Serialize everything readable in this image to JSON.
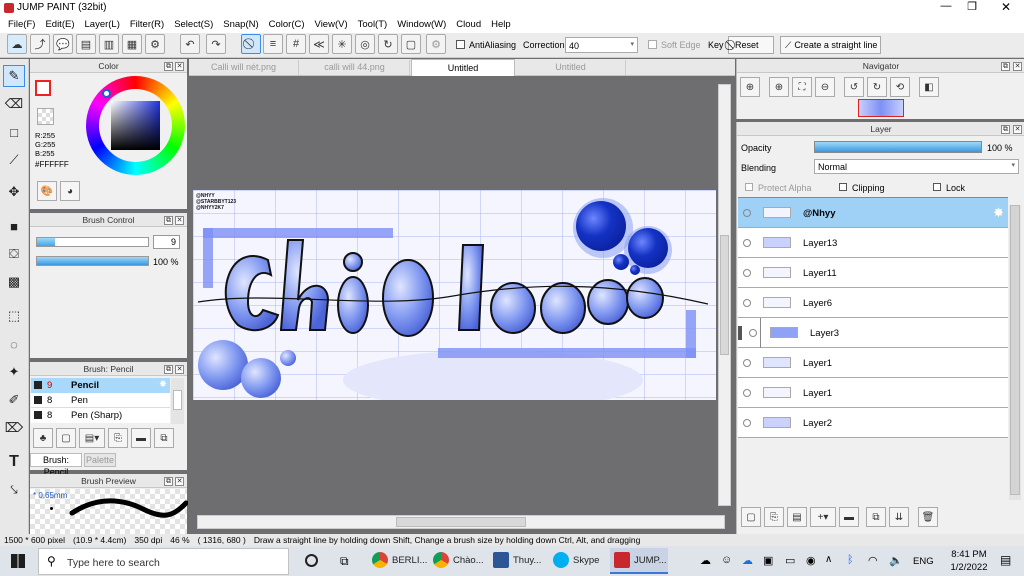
{
  "window": {
    "title": "JUMP PAINT (32bit)"
  },
  "menu": [
    "File(F)",
    "Edit(E)",
    "Layer(L)",
    "Filter(R)",
    "Select(S)",
    "Snap(N)",
    "Color(C)",
    "View(V)",
    "Tool(T)",
    "Window(W)",
    "Cloud",
    "Help"
  ],
  "toolbar": {
    "antialiasing": "AntiAliasing",
    "correction_label": "Correction",
    "correction_value": "40",
    "soft_edge": "Soft Edge",
    "key": "Key",
    "reset": "Reset",
    "straight_line": "Create a straight line"
  },
  "tabs": [
    "Calli will nét.png",
    "calli will 44.png",
    "Untitled",
    "Untitled"
  ],
  "color": {
    "title": "Color",
    "r": "R:255",
    "g": "G:255",
    "b": "B:255",
    "hex": "#FFFFFF"
  },
  "brush_control": {
    "title": "Brush Control",
    "size": "9",
    "opacity": "100 %"
  },
  "brush": {
    "title": "Brush: Pencil",
    "items": [
      {
        "size": "9",
        "name": "Pencil"
      },
      {
        "size": "8",
        "name": "Pen"
      },
      {
        "size": "8",
        "name": "Pen (Sharp)"
      }
    ],
    "tab1": "Brush: Pencil",
    "tab2": "Palette"
  },
  "brush_preview": {
    "title": "Brush Preview",
    "size": "* 0.65mm"
  },
  "navigator": {
    "title": "Navigator"
  },
  "layer_panel": {
    "title": "Layer",
    "opacity_label": "Opacity",
    "opacity_value": "100 %",
    "blending_label": "Blending",
    "blending_value": "Normal",
    "protect_alpha": "Protect Alpha",
    "clipping": "Clipping",
    "lock": "Lock",
    "layers": [
      "@Nhyy",
      "Layer13",
      "Layer11",
      "Layer6",
      "Layer3",
      "Layer1",
      "Layer1",
      "Layer2"
    ]
  },
  "canvas": {
    "tags": [
      "@NHYY",
      "@STARBBYT123",
      "@NHYY2K7"
    ]
  },
  "status": {
    "size": "1500 * 600 pixel",
    "cm": "(10.9 * 4.4cm)",
    "dpi": "350 dpi",
    "zoom": "46 %",
    "coords": "( 1316, 680 )",
    "hint": "Draw a straight line by holding down Shift, Change a brush size by holding down Ctrl, Alt, and dragging"
  },
  "taskbar": {
    "search": "Type here to search",
    "apps": [
      "BERLI...",
      "Chào...",
      "Thuy...",
      "Skype",
      "JUMP..."
    ],
    "lang": "ENG",
    "time": "8:41 PM",
    "date": "1/2/2022"
  },
  "colors": {
    "accent": "#3a8ee6",
    "selected": "#9fd0f5",
    "bubble": "#6d86f0",
    "dark_bubble": "#1433c4"
  }
}
